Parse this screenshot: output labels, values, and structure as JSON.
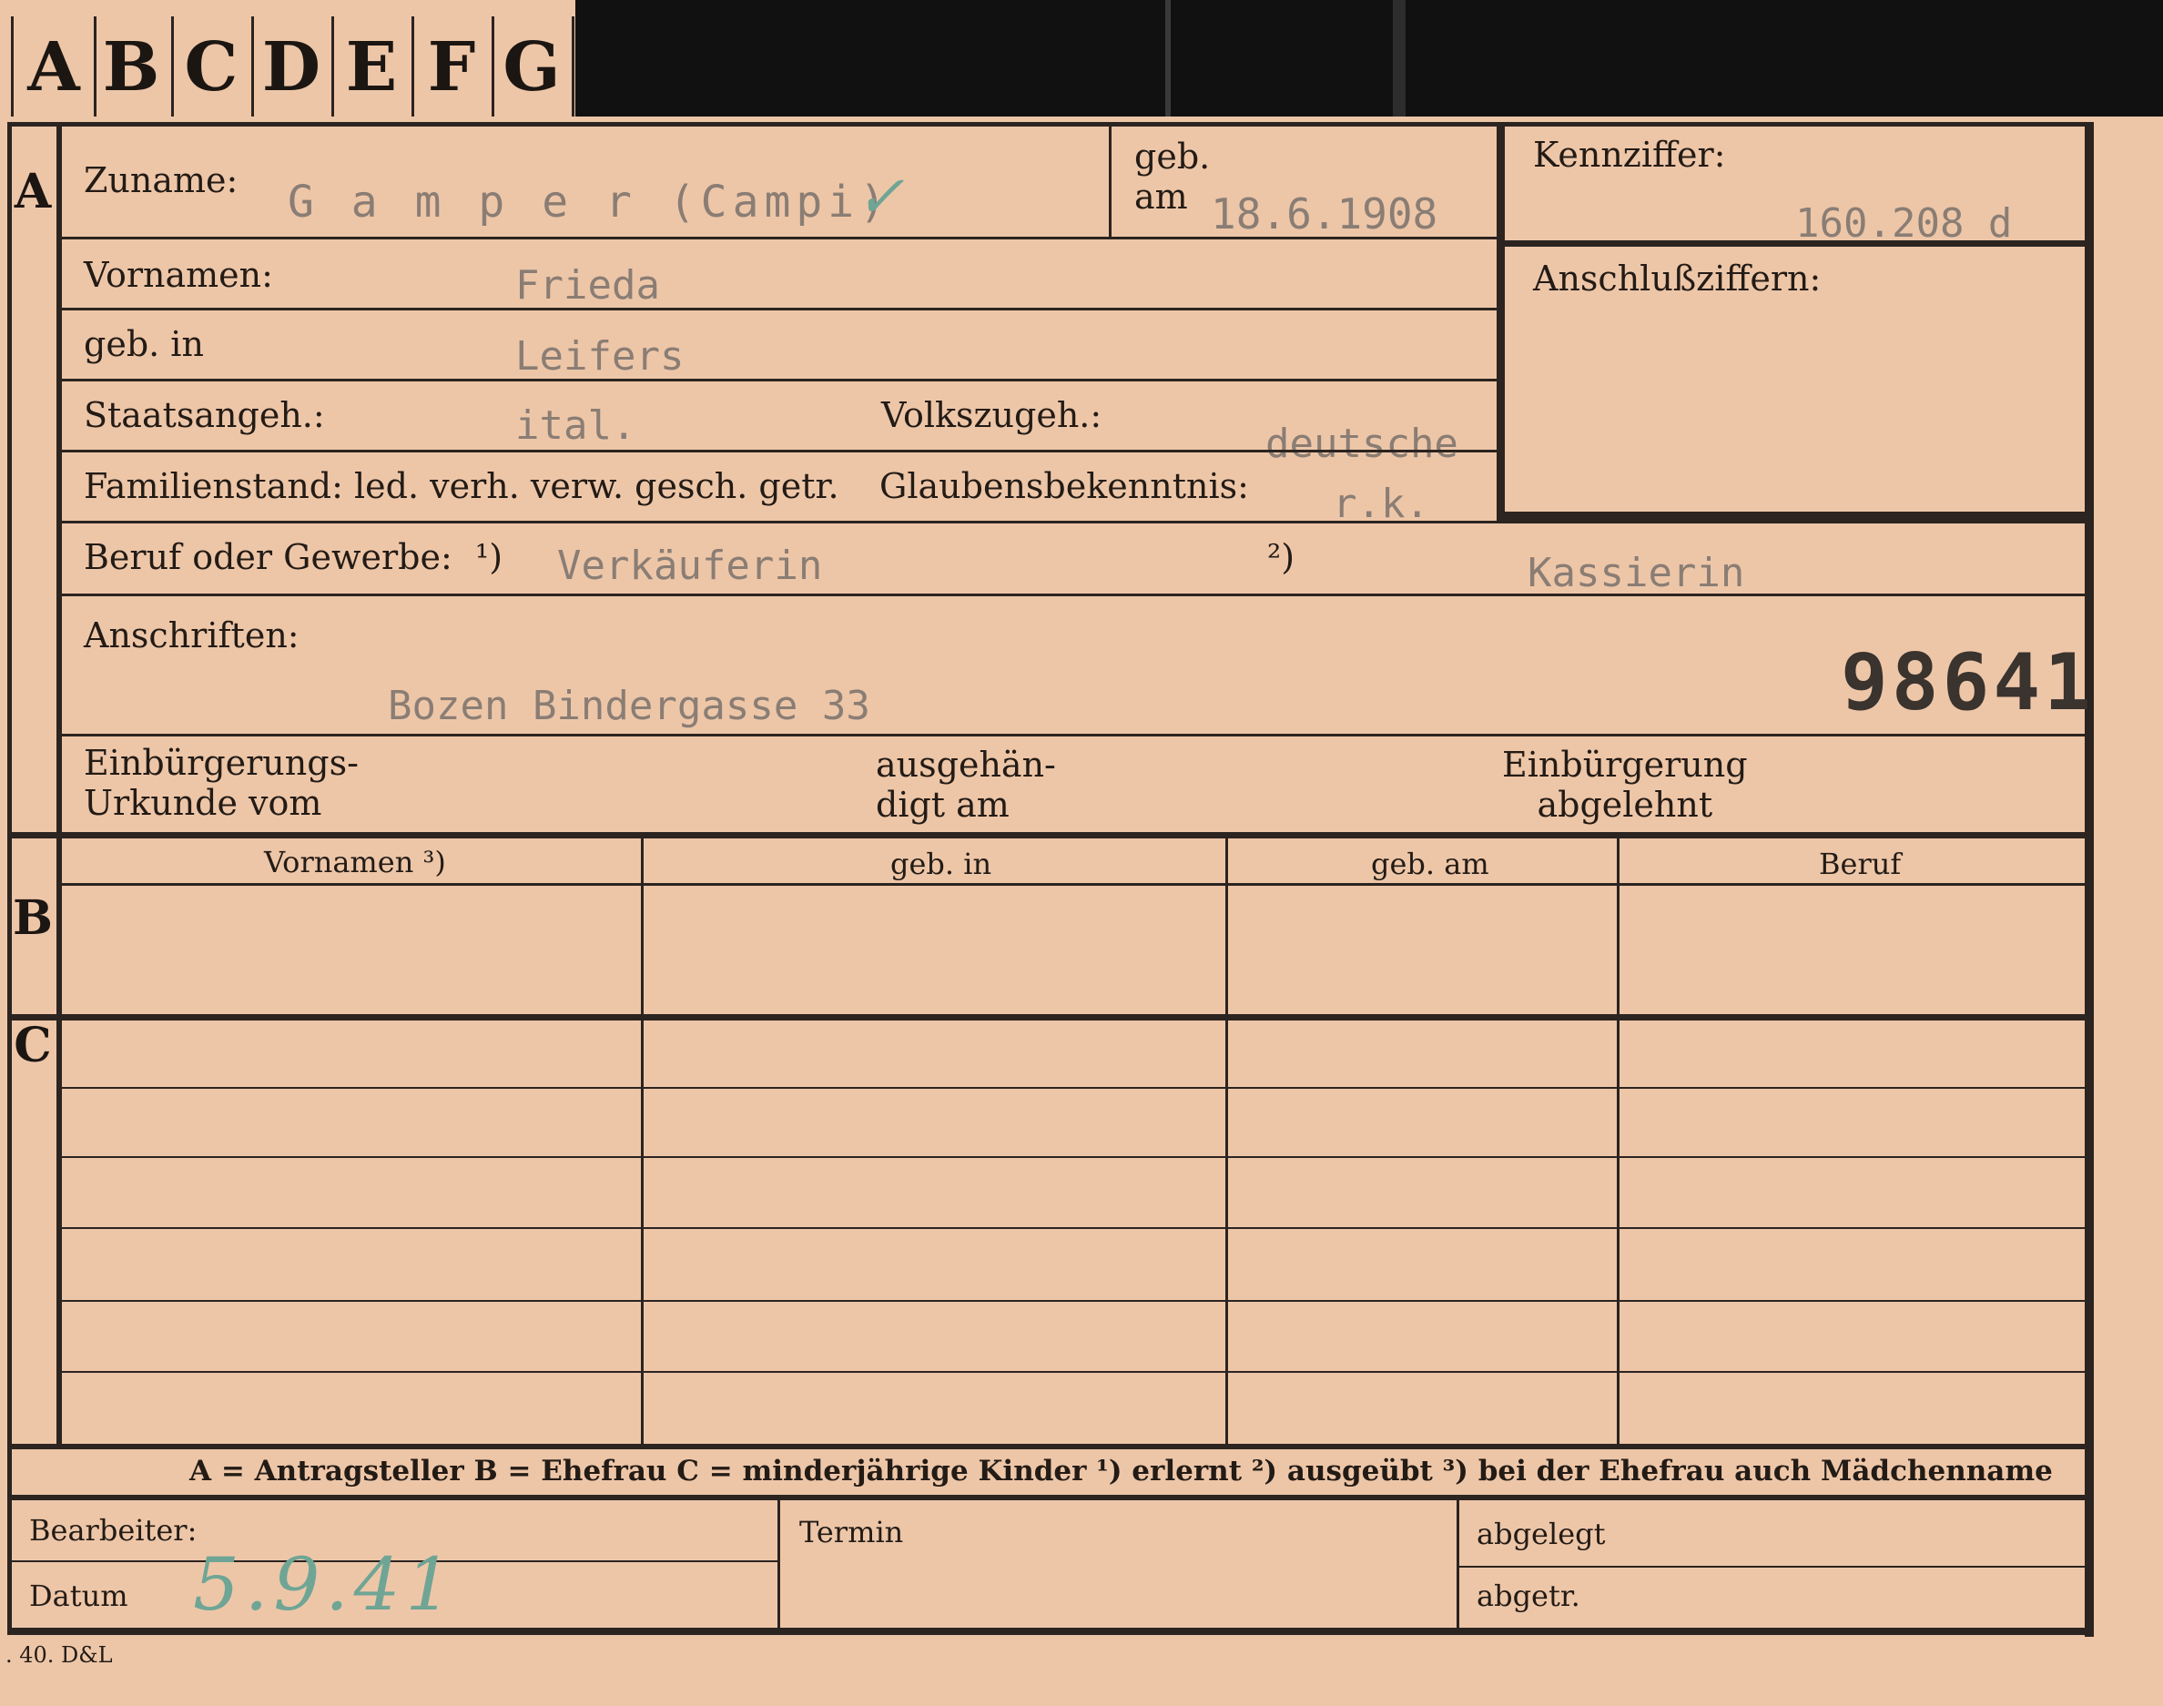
{
  "tabs": [
    "A",
    "B",
    "C",
    "D",
    "E",
    "F",
    "G"
  ],
  "sections": {
    "a": "A",
    "b": "B",
    "c": "C"
  },
  "labels": {
    "zuname": "Zuname:",
    "geb_am": "geb.\nam",
    "kennziffer": "Kennziffer:",
    "anschlussziffern": "Anschlußziffern:",
    "vornamen": "Vornamen:",
    "geb_in": "geb. in",
    "staatsangeh": "Staatsangeh.:",
    "volkszugeh": "Volkszugeh.:",
    "familienstand": "Familienstand: led. verh. verw. gesch. getr.",
    "glaubensbekenntnis": "Glaubensbekenntnis:",
    "beruf": "Beruf oder Gewerbe:",
    "beruf_note1": "¹)",
    "beruf_note2": "²)",
    "anschriften": "Anschriften:",
    "einbuergerungs_urkunde": "Einbürgerungs-\nUrkunde vom",
    "ausgehaendigt": "ausgehän-\ndigt am",
    "einbuergerung_abgelehnt": "Einbürgerung\nabgelehnt",
    "bearbeiter": "Bearbeiter:",
    "termin": "Termin",
    "abgelegt": "abgelegt",
    "datum": "Datum",
    "abgetr": "abgetr."
  },
  "record": {
    "zuname": "G a m p e r  (Campi)",
    "check": "✓",
    "geb_am": "18.6.1908",
    "kennziffer": "160.208  d",
    "vornamen": "Frieda",
    "geb_in": "Leifers",
    "staatsangeh": "ital.",
    "volkszugeh": "deutsche",
    "glaubensbekenntnis": "r.k.",
    "beruf_erlernt": "Verkäuferin",
    "beruf_ausgeuebt": "Kassierin",
    "anschrift": "Bozen Bindergasse 33",
    "stamp_number": "98641",
    "datum_handwritten": "5.9.41"
  },
  "table": {
    "headers": [
      "Vornamen ³)",
      "geb. in",
      "geb. am",
      "Beruf"
    ],
    "spouse_rows": 1,
    "children_rows": 6
  },
  "legend": "A = Antragsteller   B = Ehefrau   C = minderjährige Kinder   ¹) erlernt   ²) ausgeübt   ³) bei der Ehefrau auch Mädchenname",
  "print_mark": ". 40. D&L"
}
